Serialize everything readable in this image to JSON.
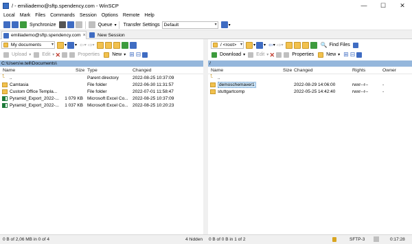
{
  "window": {
    "title": "/ - emiliademo@sftp.spendency.com - WinSCP",
    "minimize_glyph": "—",
    "maximize_glyph": "☐",
    "close_glyph": "✕"
  },
  "menu": [
    "Local",
    "Mark",
    "Files",
    "Commands",
    "Session",
    "Options",
    "Remote",
    "Help"
  ],
  "toolbar": {
    "synchronize": "Synchronize",
    "queue": "Queue",
    "transfer_settings_label": "Transfer Settings",
    "transfer_settings_value": "Default"
  },
  "tabs": {
    "session": "emiliademo@sftp.spendency.com",
    "session_close": "×",
    "new_session": "New Session"
  },
  "left": {
    "location": "My documents",
    "upload": "Upload",
    "edit": "Edit",
    "properties": "Properties",
    "new": "New",
    "path": "C:\\Users\\e.tell\\Documents\\",
    "columns": [
      "Name",
      "Size",
      "Type",
      "Changed"
    ],
    "rows": [
      {
        "name": "..",
        "size": "",
        "type": "Parent directory",
        "changed": "2022-08-25  10:37:09",
        "icon": "up"
      },
      {
        "name": "Camtasia",
        "size": "",
        "type": "File folder",
        "changed": "2022-06-30  11:31:57",
        "icon": "folder"
      },
      {
        "name": "Custom Office Templa...",
        "size": "",
        "type": "File folder",
        "changed": "2022-07-01  11:58:47",
        "icon": "folder"
      },
      {
        "name": "Pyramid_Export_2022-...",
        "size": "1 079 KB",
        "type": "Microsoft Excel Co...",
        "changed": "2022-08-25  10:37:09",
        "icon": "xls"
      },
      {
        "name": "Pyramid_Export_2022-...",
        "size": "1 037 KB",
        "type": "Microsoft Excel Co...",
        "changed": "2022-08-25  10:20:23",
        "icon": "xls"
      }
    ],
    "status": "0 B of 2,06 MB in 0 of 4",
    "hidden": "4 hidden"
  },
  "right": {
    "location": "/ <root>",
    "download": "Download",
    "edit": "Edit",
    "properties": "Properties",
    "new": "New",
    "find_files": "Find Files",
    "path": "/",
    "columns": [
      "Name",
      "Size",
      "Changed",
      "Rights",
      "Owner"
    ],
    "rows": [
      {
        "name": "..",
        "size": "",
        "changed": "",
        "rights": "",
        "owner": "",
        "icon": "up"
      },
      {
        "name": "demoschemaver1",
        "size": "",
        "changed": "2022-08-29  14:06:00",
        "rights": "rwxr--r--",
        "owner": "-",
        "icon": "folder"
      },
      {
        "name": "stuttgartcomp",
        "size": "",
        "changed": "2022-05-25  14:42:40",
        "rights": "rwxr--r--",
        "owner": "-",
        "icon": "folder"
      }
    ],
    "status": "0 B of 0 B in 1 of 2"
  },
  "status": {
    "protocol": "SFTP-3",
    "elapsed": "0:17:28"
  }
}
